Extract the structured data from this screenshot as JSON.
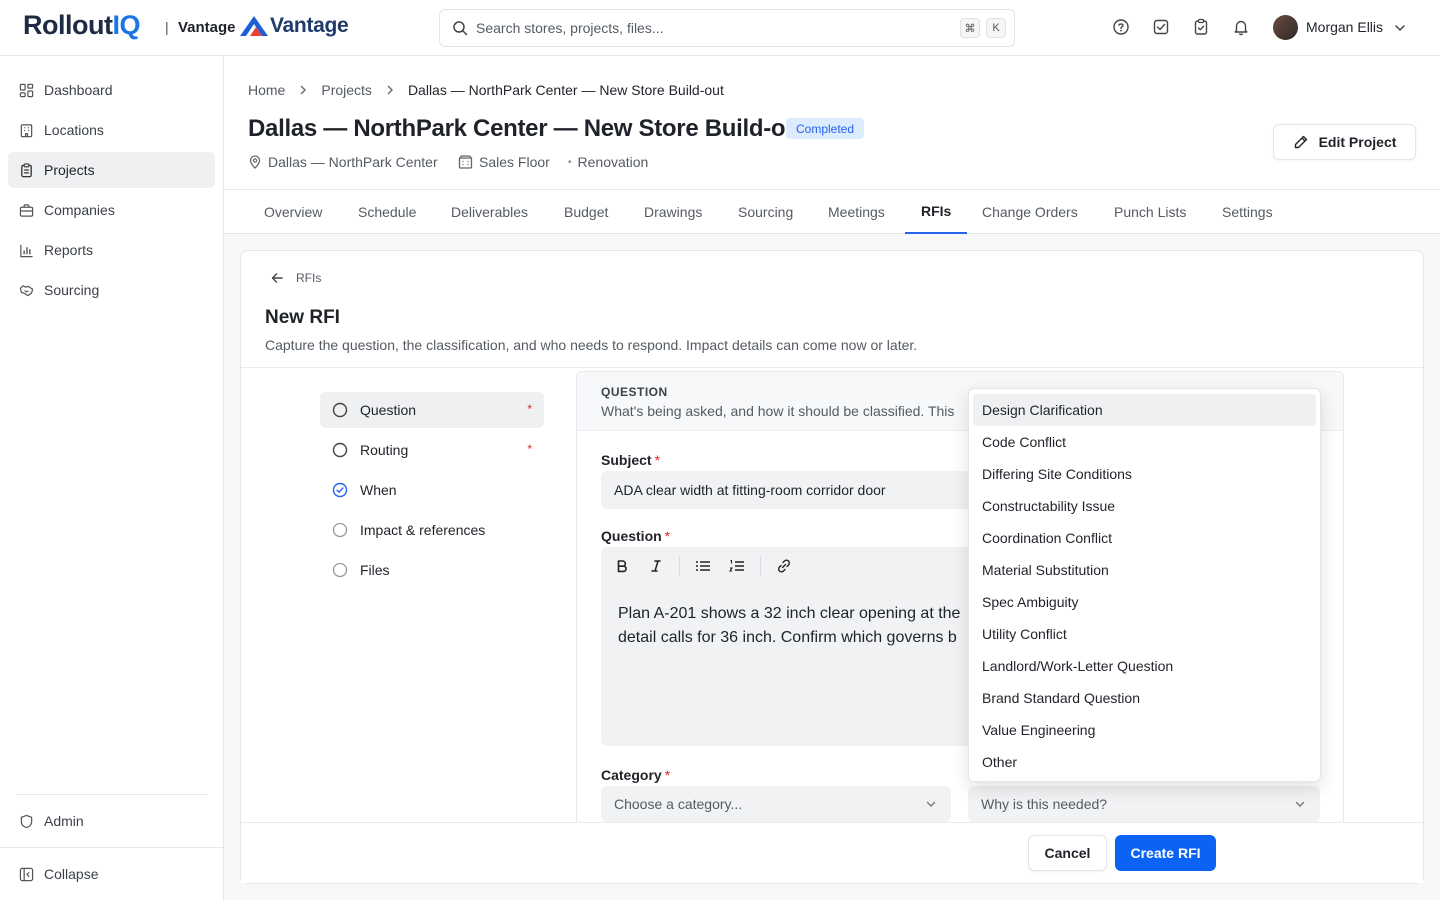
{
  "header": {
    "logo_main": "Rollout",
    "logo_accent": "IQ",
    "separator": "|",
    "tenant": "Vantage",
    "brand_name": "Vantage",
    "search_placeholder": "Search stores, projects, files...",
    "shortcut_keys": [
      "⌘",
      "K"
    ],
    "icons": [
      "help-icon",
      "tasks-icon",
      "clipboard-check-icon",
      "bell-icon"
    ],
    "user_name": "Morgan Ellis"
  },
  "sidebar": {
    "items": [
      {
        "label": "Dashboard",
        "icon": "dashboard-icon"
      },
      {
        "label": "Locations",
        "icon": "building-icon"
      },
      {
        "label": "Projects",
        "icon": "clipboard-icon",
        "active": true
      },
      {
        "label": "Companies",
        "icon": "briefcase-icon"
      },
      {
        "label": "Reports",
        "icon": "bar-chart-icon"
      },
      {
        "label": "Sourcing",
        "icon": "handshake-icon"
      }
    ],
    "admin": "Admin",
    "collapse": "Collapse"
  },
  "breadcrumb": [
    "Home",
    "Projects",
    "Dallas — NorthPark Center — New Store Build-out"
  ],
  "project": {
    "title": "Dallas — NorthPark Center — New Store Build-out",
    "status": "Completed",
    "location": "Dallas — NorthPark Center",
    "area": "Sales Floor",
    "type": "Renovation",
    "edit_label": "Edit Project"
  },
  "tabs": [
    "Overview",
    "Schedule",
    "Deliverables",
    "Budget",
    "Drawings",
    "Sourcing",
    "Meetings",
    "RFIs",
    "Change Orders",
    "Punch Lists",
    "Settings"
  ],
  "active_tab": "RFIs",
  "form": {
    "back_label": "RFIs",
    "title": "New RFI",
    "subtitle": "Capture the question, the classification, and who needs to respond. Impact details can come now or later.",
    "steps": [
      {
        "label": "Question",
        "required": "*",
        "status": "current"
      },
      {
        "label": "Routing",
        "required": "*",
        "status": "pending"
      },
      {
        "label": "When",
        "required": "",
        "status": "complete"
      },
      {
        "label": "Impact & references",
        "required": "",
        "status": "pending"
      },
      {
        "label": "Files",
        "required": "",
        "status": "pending"
      }
    ],
    "section_title": "QUESTION",
    "section_desc": "What's being asked, and how it should be classified. This",
    "subject_label": "Subject",
    "subject_value": "ADA clear width at fitting-room corridor door",
    "question_label": "Question",
    "question_lines": [
      "Plan A-201 shows a 32 inch clear opening at the",
      "detail calls for 36 inch. Confirm which governs b"
    ],
    "category_label": "Category",
    "category_placeholder": "Choose a category...",
    "reason_placeholder": "Why is this needed?",
    "required_mark": "*",
    "cancel_label": "Cancel",
    "submit_label": "Create RFI"
  },
  "dropdown": {
    "options": [
      "Design Clarification",
      "Code Conflict",
      "Differing Site Conditions",
      "Constructability Issue",
      "Coordination Conflict",
      "Material Substitution",
      "Spec Ambiguity",
      "Utility Conflict",
      "Landlord/Work-Letter Question",
      "Brand Standard Question",
      "Value Engineering",
      "Other"
    ],
    "highlighted": "Design Clarification"
  },
  "colors": {
    "accent": "#0b63f6",
    "logo_accent": "#1a73e8",
    "badge_bg": "#dcebfd",
    "required": "#dc2626"
  }
}
